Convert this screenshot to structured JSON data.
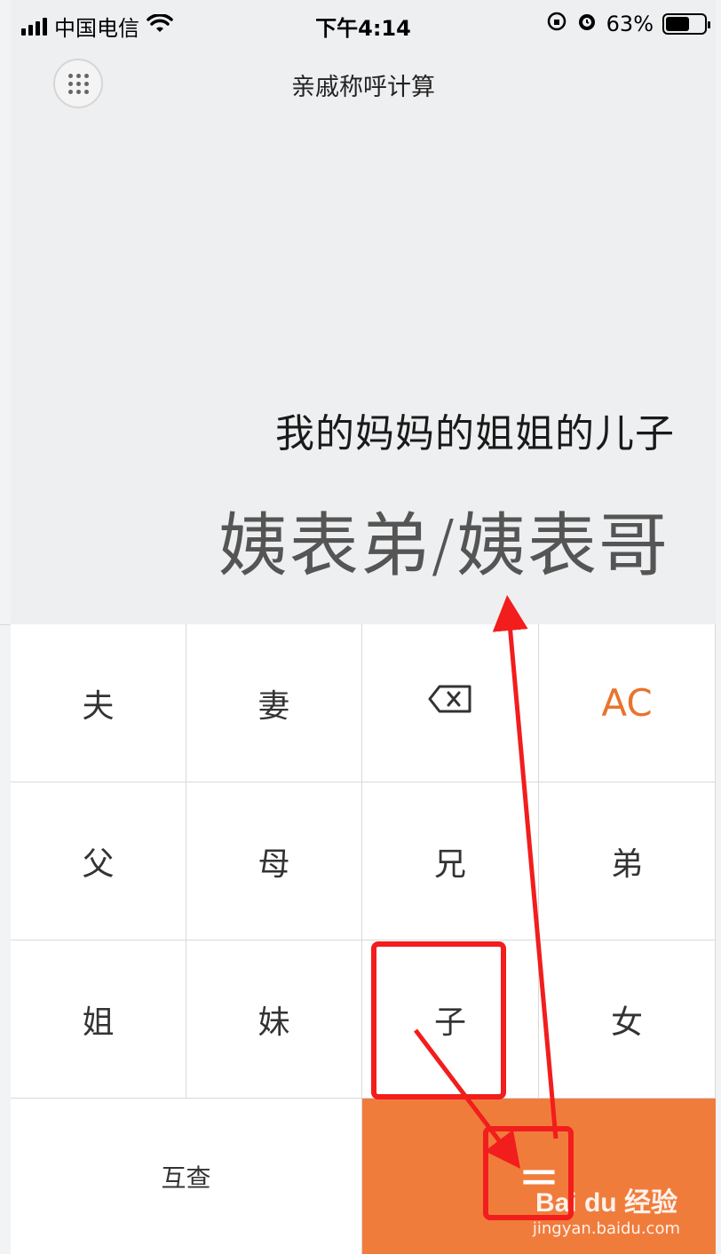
{
  "status_bar": {
    "carrier": "中国电信",
    "time": "下午4:14",
    "battery": "63%",
    "battery_level": 0.63,
    "icons": [
      "signal-icon",
      "wifi-icon",
      "rotation-lock-icon",
      "alarm-icon",
      "battery-icon"
    ]
  },
  "header": {
    "title": "亲戚称呼计算",
    "menu_icon": "grid-dots-icon"
  },
  "display": {
    "expression": "我的妈妈的姐姐的儿子",
    "result": "姨表弟/姨表哥"
  },
  "keypad": {
    "row1": [
      "夫",
      "妻",
      "⌫",
      "AC"
    ],
    "row2": [
      "父",
      "母",
      "兄",
      "弟"
    ],
    "row3": [
      "姐",
      "妹",
      "子",
      "女"
    ],
    "swap": "互查",
    "equals": "=",
    "colors": {
      "accent": "#f07c3c",
      "ac": "#e8742e"
    }
  },
  "annotation": {
    "color": "#f21d1d"
  },
  "watermark": {
    "brand": "Bai du 经验",
    "url": "jingyan.baidu.com"
  }
}
